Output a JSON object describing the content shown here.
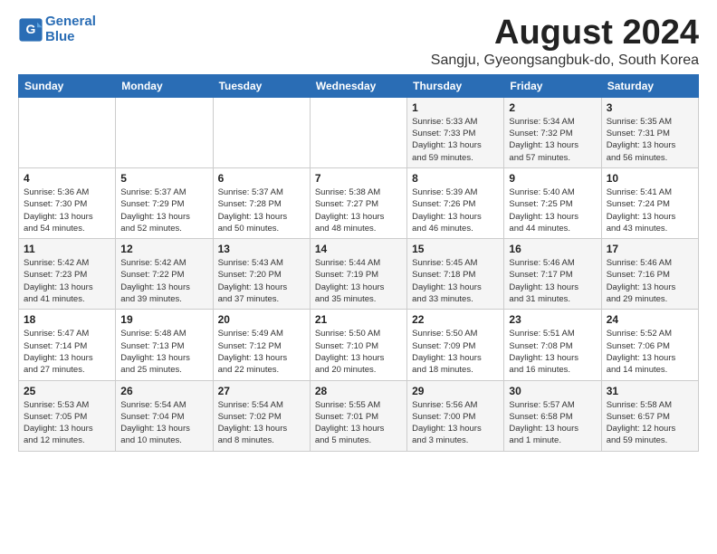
{
  "logo": {
    "line1": "General",
    "line2": "Blue"
  },
  "title": "August 2024",
  "subtitle": "Sangju, Gyeongsangbuk-do, South Korea",
  "days_of_week": [
    "Sunday",
    "Monday",
    "Tuesday",
    "Wednesday",
    "Thursday",
    "Friday",
    "Saturday"
  ],
  "weeks": [
    [
      {
        "day": "",
        "info": ""
      },
      {
        "day": "",
        "info": ""
      },
      {
        "day": "",
        "info": ""
      },
      {
        "day": "",
        "info": ""
      },
      {
        "day": "1",
        "info": "Sunrise: 5:33 AM\nSunset: 7:33 PM\nDaylight: 13 hours\nand 59 minutes."
      },
      {
        "day": "2",
        "info": "Sunrise: 5:34 AM\nSunset: 7:32 PM\nDaylight: 13 hours\nand 57 minutes."
      },
      {
        "day": "3",
        "info": "Sunrise: 5:35 AM\nSunset: 7:31 PM\nDaylight: 13 hours\nand 56 minutes."
      }
    ],
    [
      {
        "day": "4",
        "info": "Sunrise: 5:36 AM\nSunset: 7:30 PM\nDaylight: 13 hours\nand 54 minutes."
      },
      {
        "day": "5",
        "info": "Sunrise: 5:37 AM\nSunset: 7:29 PM\nDaylight: 13 hours\nand 52 minutes."
      },
      {
        "day": "6",
        "info": "Sunrise: 5:37 AM\nSunset: 7:28 PM\nDaylight: 13 hours\nand 50 minutes."
      },
      {
        "day": "7",
        "info": "Sunrise: 5:38 AM\nSunset: 7:27 PM\nDaylight: 13 hours\nand 48 minutes."
      },
      {
        "day": "8",
        "info": "Sunrise: 5:39 AM\nSunset: 7:26 PM\nDaylight: 13 hours\nand 46 minutes."
      },
      {
        "day": "9",
        "info": "Sunrise: 5:40 AM\nSunset: 7:25 PM\nDaylight: 13 hours\nand 44 minutes."
      },
      {
        "day": "10",
        "info": "Sunrise: 5:41 AM\nSunset: 7:24 PM\nDaylight: 13 hours\nand 43 minutes."
      }
    ],
    [
      {
        "day": "11",
        "info": "Sunrise: 5:42 AM\nSunset: 7:23 PM\nDaylight: 13 hours\nand 41 minutes."
      },
      {
        "day": "12",
        "info": "Sunrise: 5:42 AM\nSunset: 7:22 PM\nDaylight: 13 hours\nand 39 minutes."
      },
      {
        "day": "13",
        "info": "Sunrise: 5:43 AM\nSunset: 7:20 PM\nDaylight: 13 hours\nand 37 minutes."
      },
      {
        "day": "14",
        "info": "Sunrise: 5:44 AM\nSunset: 7:19 PM\nDaylight: 13 hours\nand 35 minutes."
      },
      {
        "day": "15",
        "info": "Sunrise: 5:45 AM\nSunset: 7:18 PM\nDaylight: 13 hours\nand 33 minutes."
      },
      {
        "day": "16",
        "info": "Sunrise: 5:46 AM\nSunset: 7:17 PM\nDaylight: 13 hours\nand 31 minutes."
      },
      {
        "day": "17",
        "info": "Sunrise: 5:46 AM\nSunset: 7:16 PM\nDaylight: 13 hours\nand 29 minutes."
      }
    ],
    [
      {
        "day": "18",
        "info": "Sunrise: 5:47 AM\nSunset: 7:14 PM\nDaylight: 13 hours\nand 27 minutes."
      },
      {
        "day": "19",
        "info": "Sunrise: 5:48 AM\nSunset: 7:13 PM\nDaylight: 13 hours\nand 25 minutes."
      },
      {
        "day": "20",
        "info": "Sunrise: 5:49 AM\nSunset: 7:12 PM\nDaylight: 13 hours\nand 22 minutes."
      },
      {
        "day": "21",
        "info": "Sunrise: 5:50 AM\nSunset: 7:10 PM\nDaylight: 13 hours\nand 20 minutes."
      },
      {
        "day": "22",
        "info": "Sunrise: 5:50 AM\nSunset: 7:09 PM\nDaylight: 13 hours\nand 18 minutes."
      },
      {
        "day": "23",
        "info": "Sunrise: 5:51 AM\nSunset: 7:08 PM\nDaylight: 13 hours\nand 16 minutes."
      },
      {
        "day": "24",
        "info": "Sunrise: 5:52 AM\nSunset: 7:06 PM\nDaylight: 13 hours\nand 14 minutes."
      }
    ],
    [
      {
        "day": "25",
        "info": "Sunrise: 5:53 AM\nSunset: 7:05 PM\nDaylight: 13 hours\nand 12 minutes."
      },
      {
        "day": "26",
        "info": "Sunrise: 5:54 AM\nSunset: 7:04 PM\nDaylight: 13 hours\nand 10 minutes."
      },
      {
        "day": "27",
        "info": "Sunrise: 5:54 AM\nSunset: 7:02 PM\nDaylight: 13 hours\nand 8 minutes."
      },
      {
        "day": "28",
        "info": "Sunrise: 5:55 AM\nSunset: 7:01 PM\nDaylight: 13 hours\nand 5 minutes."
      },
      {
        "day": "29",
        "info": "Sunrise: 5:56 AM\nSunset: 7:00 PM\nDaylight: 13 hours\nand 3 minutes."
      },
      {
        "day": "30",
        "info": "Sunrise: 5:57 AM\nSunset: 6:58 PM\nDaylight: 13 hours\nand 1 minute."
      },
      {
        "day": "31",
        "info": "Sunrise: 5:58 AM\nSunset: 6:57 PM\nDaylight: 12 hours\nand 59 minutes."
      }
    ]
  ]
}
